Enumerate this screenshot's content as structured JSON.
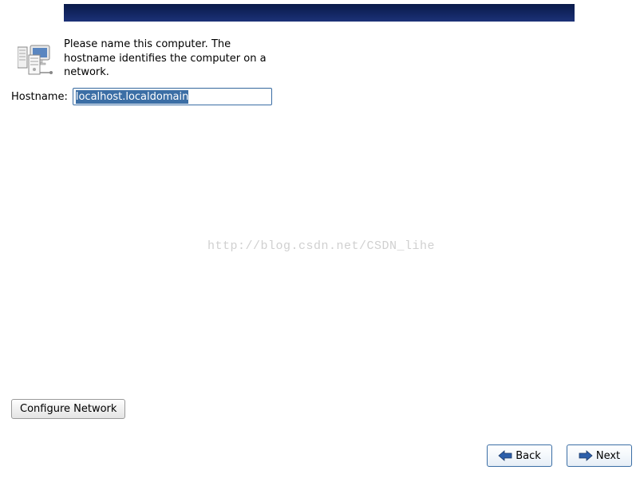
{
  "description": "Please name this computer.  The hostname identifies the computer on a network.",
  "hostname": {
    "label": "Hostname:",
    "value": "localhost.localdomain"
  },
  "buttons": {
    "configure_network": "Configure Network",
    "back": "Back",
    "next": "Next"
  },
  "watermark": "http://blog.csdn.net/CSDN_lihe"
}
